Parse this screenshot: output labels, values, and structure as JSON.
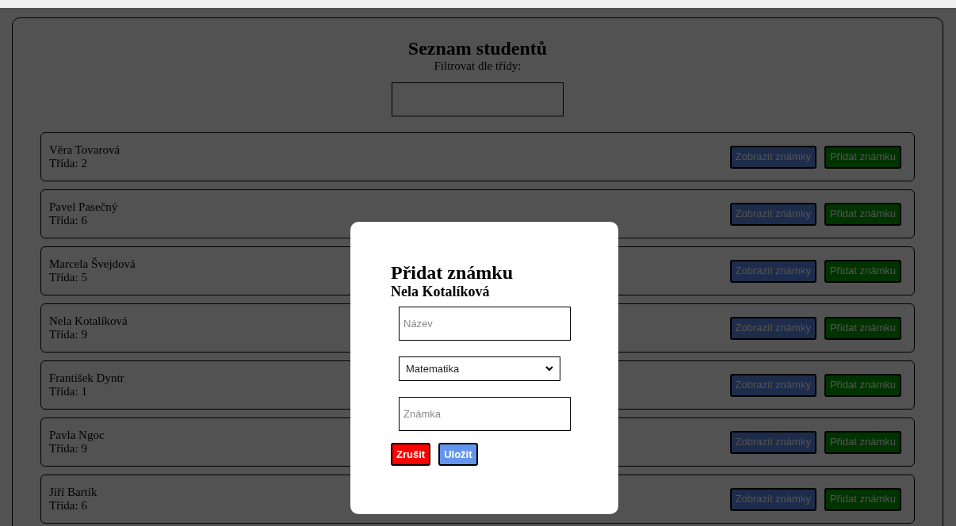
{
  "page": {
    "title": "Seznam studentů",
    "filter_label": "Filtrovat dle třídy:"
  },
  "students": [
    {
      "name": "Věra Tovarová",
      "class": "Třída: 2",
      "show_button": "Zobrazit známky",
      "add_button": "Přidat známku"
    },
    {
      "name": "Pavel Pasečný",
      "class": "Třída: 6",
      "show_button": "Zobrazit známky",
      "add_button": "Přidat známku"
    },
    {
      "name": "Marcela Švejdová",
      "class": "Třída: 5",
      "show_button": "Zobrazit známky",
      "add_button": "Přidat známku"
    },
    {
      "name": "Nela Kotalíková",
      "class": "Třída: 9",
      "show_button": "Zobrazit známky",
      "add_button": "Přidat známku"
    },
    {
      "name": "František Dyntr",
      "class": "Třída: 1",
      "show_button": "Zobrazit známky",
      "add_button": "Přidat známku"
    },
    {
      "name": "Pavla Ngoc",
      "class": "Třída: 9",
      "show_button": "Zobrazit známky",
      "add_button": "Přidat známku"
    },
    {
      "name": "Jiří Bartík",
      "class": "Třída: 6",
      "show_button": "Zobrazit známky",
      "add_button": "Přidat známku"
    }
  ],
  "dialog": {
    "title": "Přidat známku",
    "student": "Nela Kotalíková",
    "name_field": {
      "placeholder": "Název"
    },
    "subject_select": {
      "value": "Matematika"
    },
    "grade_field": {
      "placeholder": "Známka"
    },
    "cancel_button": "Zrušit",
    "save_button": "Uložit"
  }
}
